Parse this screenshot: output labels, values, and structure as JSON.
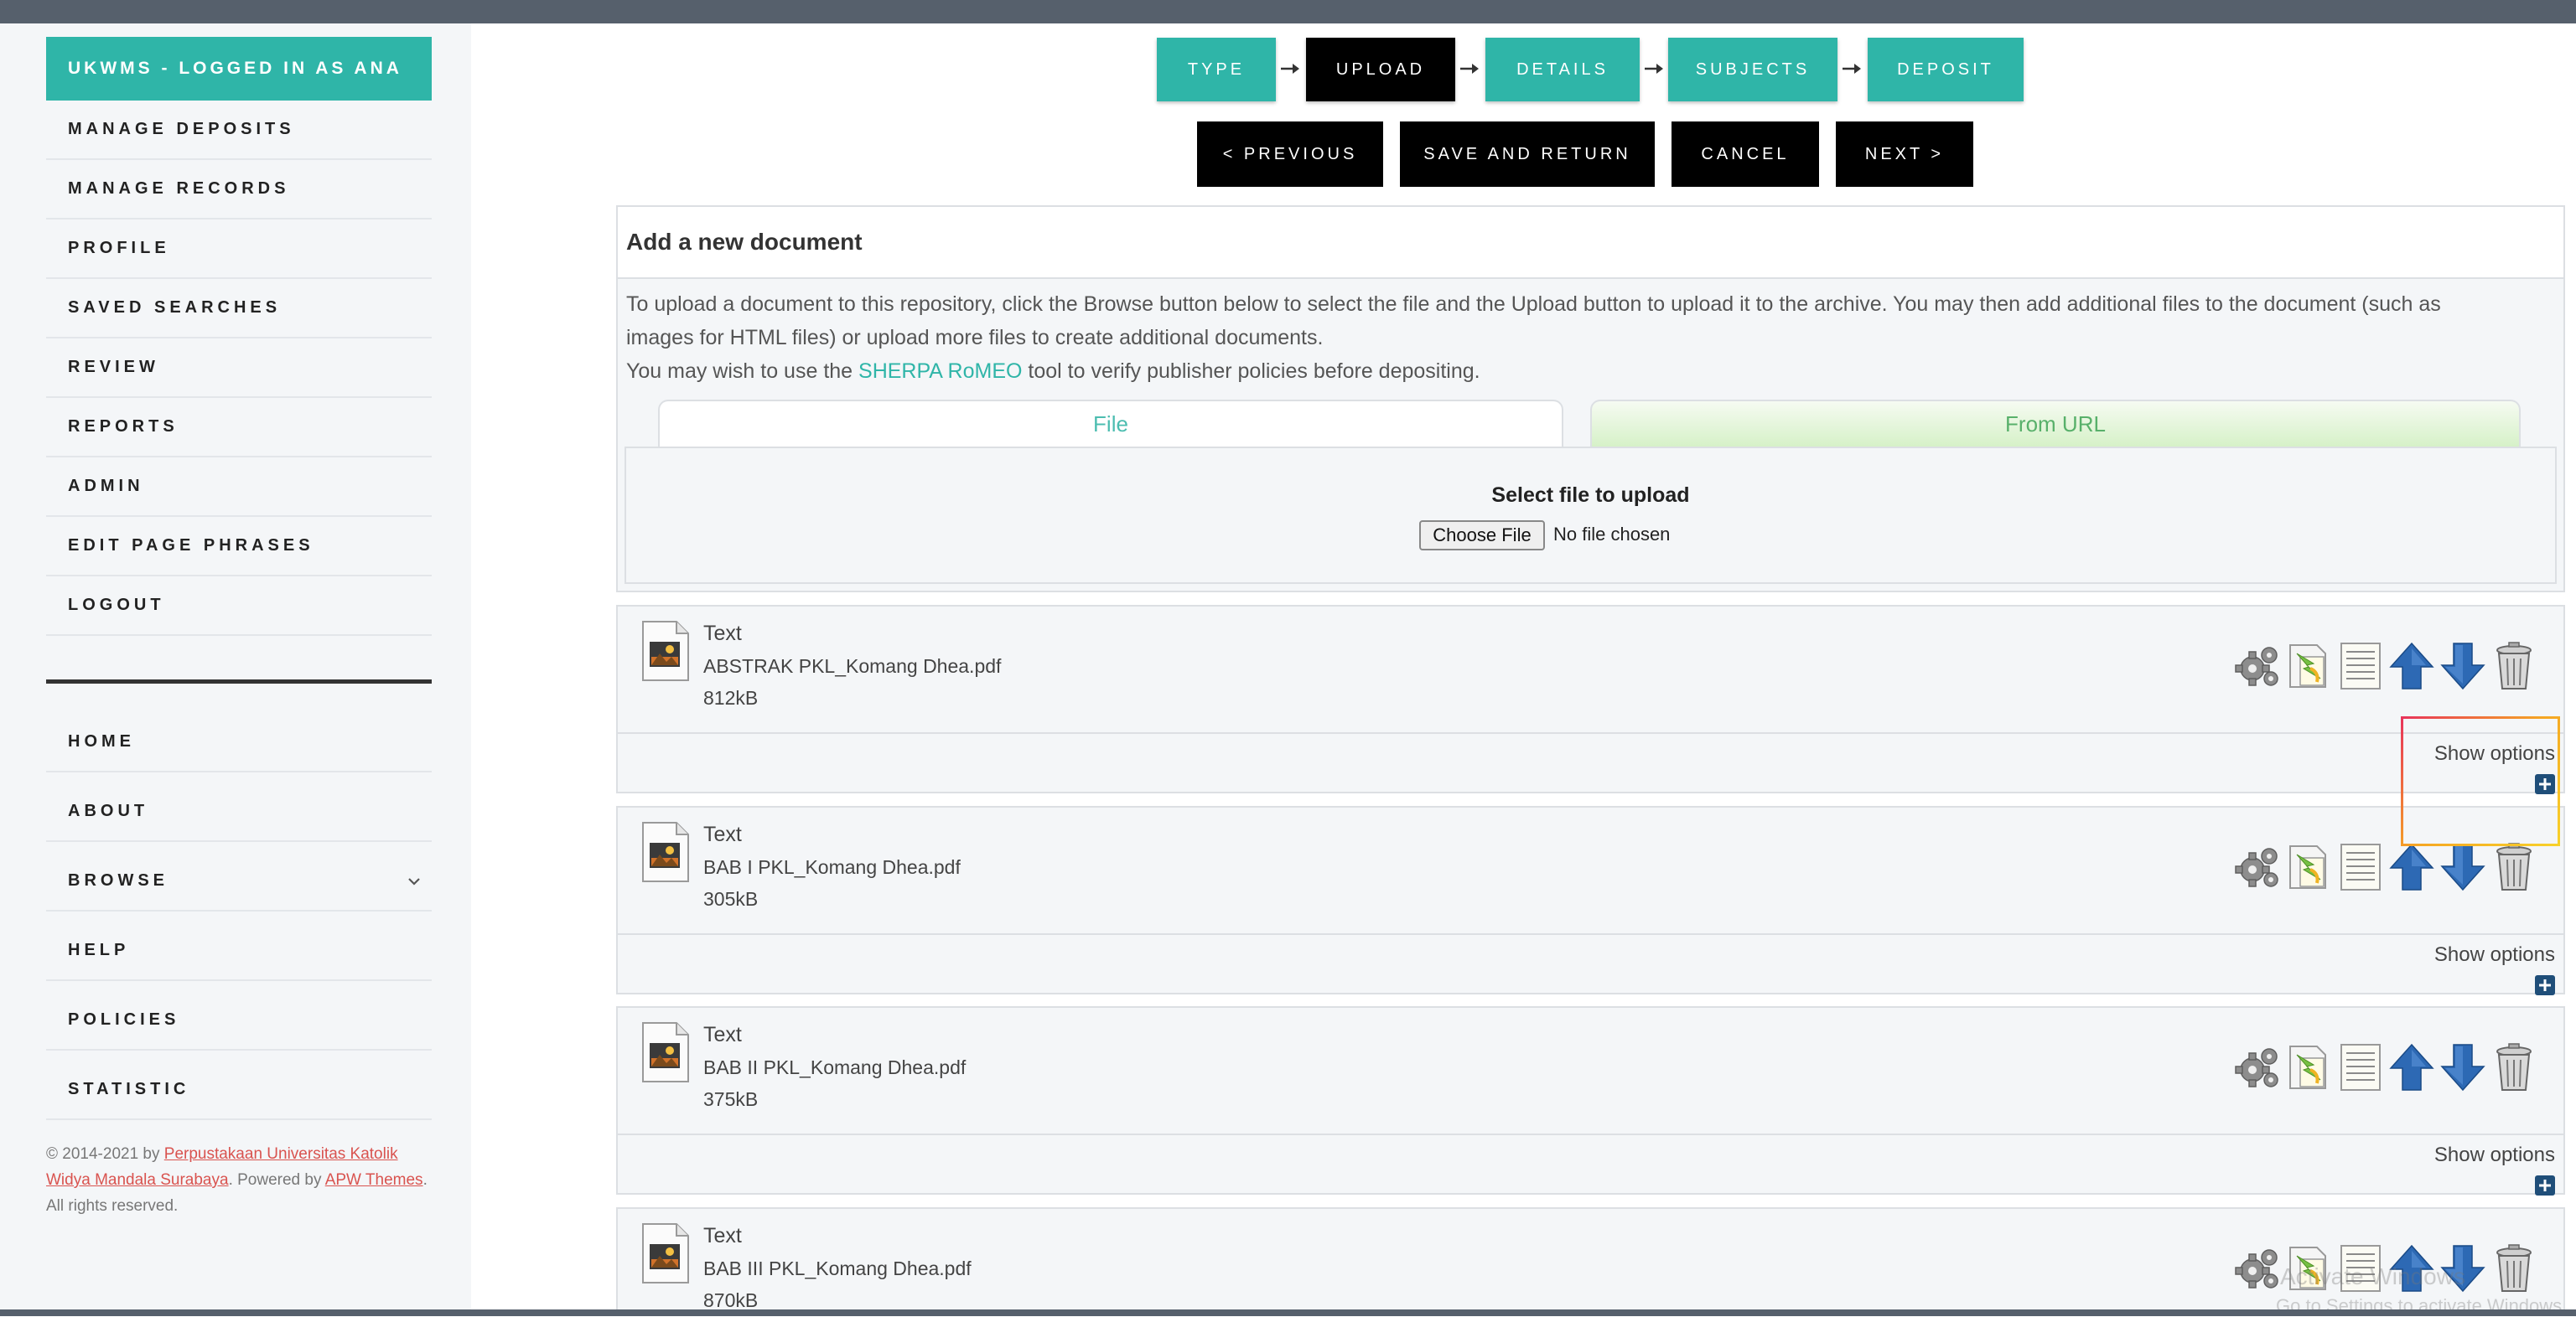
{
  "sidebar": {
    "title": "UKWMS - LOGGED IN AS ANA",
    "items": [
      {
        "label": "MANAGE DEPOSITS"
      },
      {
        "label": "MANAGE RECORDS"
      },
      {
        "label": "PROFILE"
      },
      {
        "label": "SAVED SEARCHES"
      },
      {
        "label": "REVIEW"
      },
      {
        "label": "REPORTS"
      },
      {
        "label": "ADMIN"
      },
      {
        "label": "EDIT PAGE PHRASES"
      },
      {
        "label": "LOGOUT"
      }
    ],
    "nav": [
      {
        "label": "HOME"
      },
      {
        "label": "ABOUT"
      },
      {
        "label": "BROWSE"
      },
      {
        "label": "HELP"
      },
      {
        "label": "POLICIES"
      },
      {
        "label": "STATISTIC"
      }
    ],
    "footer": {
      "prefix": "© 2014-2021 by ",
      "org_link": "Perpustakaan Universitas Katolik Widya Mandala Surabaya",
      "powered": ". Powered by ",
      "theme_link": "APW Themes",
      "suffix": ". All rights reserved."
    }
  },
  "steps": [
    {
      "label": "TYPE"
    },
    {
      "label": "UPLOAD"
    },
    {
      "label": "DETAILS"
    },
    {
      "label": "SUBJECTS"
    },
    {
      "label": "DEPOSIT"
    }
  ],
  "actions": {
    "previous": "< PREVIOUS",
    "save_return": "SAVE AND RETURN",
    "cancel": "CANCEL",
    "next": "NEXT >"
  },
  "panel": {
    "title": "Add a new document",
    "desc_line1": "To upload a document to this repository, click the Browse button below to select the file and the Upload button to upload it to the archive. You may then add additional files to the document (such as",
    "desc_line2": "images for HTML files) or upload more files to create additional documents.",
    "desc3_prefix": "You may wish to use the ",
    "desc3_link": "SHERPA RoMEO",
    "desc3_suffix": " tool to verify publisher policies before depositing.",
    "tab_file": "File",
    "tab_url": "From URL",
    "upload_label": "Select file to upload",
    "choose_file": "Choose File",
    "no_file": "No file chosen"
  },
  "documents": [
    {
      "type": "Text",
      "name": "ABSTRAK PKL_Komang Dhea.pdf",
      "size": "812kB",
      "show_options": "Show options"
    },
    {
      "type": "Text",
      "name": "BAB I PKL_Komang Dhea.pdf",
      "size": "305kB",
      "show_options": "Show options"
    },
    {
      "type": "Text",
      "name": "BAB II PKL_Komang Dhea.pdf",
      "size": "375kB",
      "show_options": "Show options"
    },
    {
      "type": "Text",
      "name": "BAB III PKL_Komang Dhea.pdf",
      "size": "870kB",
      "show_options": ""
    }
  ],
  "watermark": {
    "line1": "Activate Windows",
    "line2": "Go to Settings to activate Windows."
  },
  "colors": {
    "accent": "#2fb5a8",
    "link_red": "#d9534f",
    "active_step": "#000000"
  }
}
